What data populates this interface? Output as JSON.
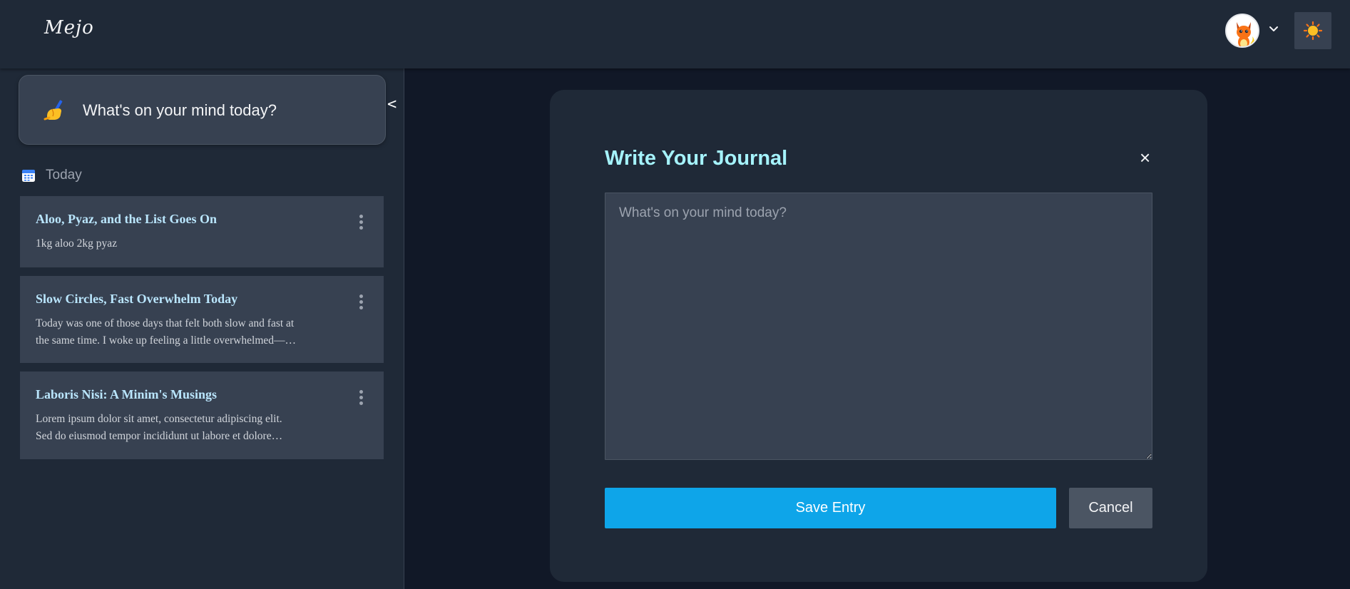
{
  "header": {
    "logo": "Mejo",
    "avatar_icon": "dragon-avatar-icon",
    "menu_icon": "chevron-down-icon",
    "theme_icon": "sun-icon"
  },
  "sidebar": {
    "prompt_card": {
      "emoji": "writing-hand-icon",
      "text": "What's on your mind today?"
    },
    "collapse_label": "<",
    "section": {
      "icon": "calendar-icon",
      "label": "Today"
    },
    "entries": [
      {
        "title": "Aloo, Pyaz, and the List Goes On",
        "lines": [
          "1kg aloo 2kg pyaz"
        ]
      },
      {
        "title": "Slow Circles, Fast Overwhelm Today",
        "lines": [
          "Today was one of those days that felt both slow and fast at",
          "the same time. I woke up feeling a little overwhelmed—…"
        ]
      },
      {
        "title": "Laboris Nisi: A Minim's Musings",
        "lines": [
          "Lorem ipsum dolor sit amet, consectetur adipiscing elit.",
          "Sed do eiusmod tempor incididunt ut labore et dolore…"
        ]
      }
    ]
  },
  "modal": {
    "title": "Write Your Journal",
    "close_label": "×",
    "input": {
      "value": "",
      "placeholder": "What's on your mind today?"
    },
    "save_label": "Save Entry",
    "cancel_label": "Cancel"
  },
  "colors": {
    "accent": "#0ea5e9",
    "title": "#a5f3fc",
    "entry_title": "#bae6fd",
    "background": "#111827",
    "panel": "#1f2937",
    "card": "#374151"
  }
}
